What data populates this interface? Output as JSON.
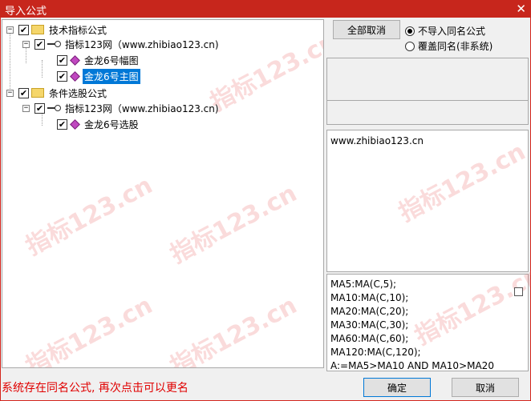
{
  "window": {
    "title": "导入公式",
    "close_glyph": "✕"
  },
  "watermark_text": "指标123.cn",
  "tree": {
    "groups": [
      {
        "label": "技术指标公式",
        "source": "指标123网（www.zhibiao123.cn)",
        "items": [
          "金龙6号幅图",
          "金龙6号主图"
        ]
      },
      {
        "label": "条件选股公式",
        "source": "指标123网（www.zhibiao123.cn)",
        "items": [
          "金龙6号选股"
        ]
      }
    ],
    "checked_glyph": "✔",
    "collapse_glyph": "−"
  },
  "buttons": {
    "cancel_all": "全部取消",
    "ok": "确定",
    "cancel": "取消"
  },
  "options": {
    "no_import": "不导入同名公式",
    "overwrite": "覆盖同名(非系统)",
    "selected": "no_import"
  },
  "description": "www.zhibiao123.cn",
  "source_code": [
    "MA5:MA(C,5);",
    "MA10:MA(C,10);",
    "MA20:MA(C,20);",
    "MA30:MA(C,30);",
    "MA60:MA(C,60);",
    "MA120:MA(C,120);",
    "A:=MA5>MA10 AND MA10>MA20"
  ],
  "status_message": "系统存在同名公式, 再次点击可以更名",
  "colors": {
    "title_bar": "#c7261c",
    "status_text": "#e00000",
    "selection": "#0078d7"
  }
}
